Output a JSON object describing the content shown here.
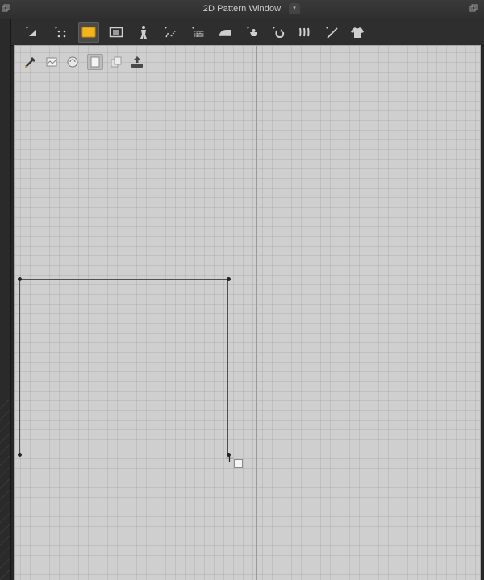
{
  "window": {
    "title": "2D Pattern Window",
    "dropdown_glyph": "▾"
  },
  "toolbar": {
    "tools": [
      {
        "name": "transform-pattern-icon"
      },
      {
        "name": "edit-point-icon"
      },
      {
        "name": "rectangle-tool-icon",
        "active": true
      },
      {
        "name": "internal-rectangle-icon"
      },
      {
        "name": "fold-arrangement-icon"
      },
      {
        "name": "segment-sewing-icon"
      },
      {
        "name": "edit-sewing-icon"
      },
      {
        "name": "iron-icon"
      },
      {
        "name": "pin-icon"
      },
      {
        "name": "tack-icon"
      },
      {
        "name": "elastic-icon"
      },
      {
        "name": "measure-line-icon"
      },
      {
        "name": "garment-icon"
      }
    ]
  },
  "canvas_toolbar": {
    "tools": [
      {
        "name": "draw-tool-icon"
      },
      {
        "name": "texture-tool-icon"
      },
      {
        "name": "texture-edit-icon"
      },
      {
        "name": "layer-tool-icon",
        "active": true
      },
      {
        "name": "layer-duplicate-icon"
      },
      {
        "name": "export-icon"
      }
    ]
  },
  "colors": {
    "accent_active_tool": "#f2b51c",
    "canvas_background": "#cfcfcf",
    "grid_line": "#bdbdbd",
    "axis_line": "#9a9a9a",
    "pattern_outline": "#505050"
  }
}
